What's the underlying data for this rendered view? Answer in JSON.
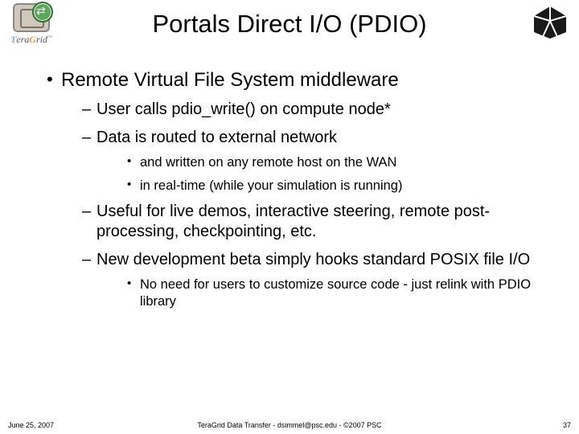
{
  "title": "Portals Direct I/O (PDIO)",
  "logo": {
    "t": "T",
    "era": "era",
    "g": "G",
    "rid": "rid",
    "tm": "™"
  },
  "bullets": [
    {
      "text": "Remote Virtual File System middleware",
      "children": [
        {
          "text": "User calls pdio_write() on compute node*"
        },
        {
          "text": "Data is routed to external network",
          "children": [
            {
              "text": "and written on any remote host on the WAN"
            },
            {
              "text": "in real-time (while your simulation is running)"
            }
          ]
        },
        {
          "text": "Useful for live demos, interactive steering, remote post-processing, checkpointing, etc."
        },
        {
          "text": "New development beta simply hooks standard POSIX file I/O",
          "children": [
            {
              "text": "No need for users to customize source code - just relink with PDIO library"
            }
          ]
        }
      ]
    }
  ],
  "footer": {
    "date": "June 25, 2007",
    "center": "TeraGrid Data Transfer - dsimmel@psc.edu - ©2007 PSC",
    "page": "37"
  }
}
